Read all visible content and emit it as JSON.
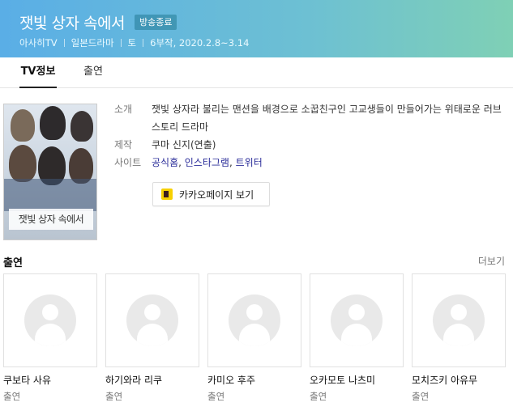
{
  "header": {
    "title": "잿빛 상자 속에서",
    "badge": "방송종료",
    "channel": "아사히TV",
    "genre": "일본드라마",
    "day": "토",
    "schedule": "6부작, 2020.2.8~3.14"
  },
  "tabs": [
    {
      "label": "TV정보",
      "active": true
    },
    {
      "label": "출연",
      "active": false
    }
  ],
  "poster": {
    "title_text": "잿빛 상자 속에서"
  },
  "info": {
    "synopsis_label": "소개",
    "synopsis": "잿빛 상자라 불리는 맨션을 배경으로 소꿉친구인 고교생들이 만들어가는 위태로운 러브 스토리 드라마",
    "production_label": "제작",
    "production": "쿠마 신지(연출)",
    "site_label": "사이트",
    "sites": [
      "공식홈",
      "인스타그램",
      "트위터"
    ],
    "kakao_button": "카카오페이지 보기"
  },
  "cast": {
    "heading": "출연",
    "more": "더보기",
    "members": [
      {
        "name": "쿠보타 사유",
        "role": "출연"
      },
      {
        "name": "하기와라 리쿠",
        "role": "출연"
      },
      {
        "name": "카미오 후주",
        "role": "출연"
      },
      {
        "name": "오카모토 나츠미",
        "role": "출연"
      },
      {
        "name": "모치즈키 아유무",
        "role": "출연"
      }
    ]
  }
}
